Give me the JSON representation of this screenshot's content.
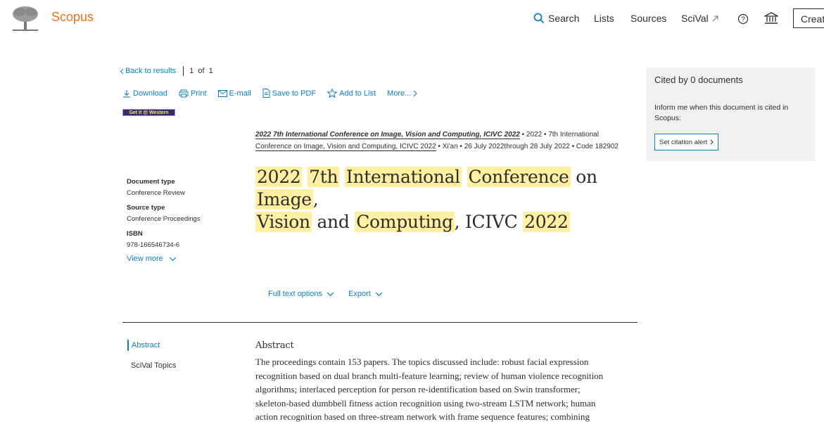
{
  "header": {
    "brand": "Scopus",
    "nav": {
      "search": "Search",
      "lists": "Lists",
      "sources": "Sources",
      "scival": "SciVal"
    },
    "create": "Creat"
  },
  "back": {
    "back_label": "Back to results",
    "pager": "1  of  1"
  },
  "toolbar": {
    "download": "Download",
    "print": "Print",
    "email": "E-mail",
    "save_pdf": "Save to PDF",
    "add_list": "Add to List",
    "more": "More..."
  },
  "getit": "Get it @ Western",
  "source": {
    "title": "2022 7th International Conference on Image, Vision and Computing, ICIVC 2022",
    "year": "2022",
    "conf_a": "7th International",
    "conf_b": "Conference on Image, Vision and Computing, ICIVC 2022",
    "location": "Xi'an",
    "dates": "26 July 2022through 28 July 2022",
    "code": "Code 182902"
  },
  "title_words": [
    "2022",
    "7th",
    "International",
    "Conference",
    "on",
    "Image",
    ",",
    "Vision",
    "and",
    "Computing",
    ", ICIVC",
    "2022"
  ],
  "meta": {
    "doc_type_label": "Document type",
    "doc_type": "Conference Review",
    "source_type_label": "Source type",
    "source_type": "Conference Proceedings",
    "isbn_label": "ISBN",
    "isbn": "978-166546734-6",
    "view_more": "View more"
  },
  "actions": {
    "full_text": "Full text options",
    "export": "Export"
  },
  "side_nav": {
    "abstract": "Abstract",
    "scival_topics": "SciVal Topics"
  },
  "abstract": {
    "heading": "Abstract",
    "lines": [
      "The proceedings contain 153 papers. The topics discussed include: robust facial expression",
      "recognition based on dual branch multi-feature learning; review of human violence recognition",
      "algorithms; interlaced perception for person re-identification based on Swin transformer;",
      "skeleton-based dumbbell fitness action recognition using two-stream LSTM network; human",
      "action recognition based on three-stream network with frame sequence features; combining"
    ]
  },
  "cited": {
    "title": "Cited by 0 documents",
    "inform": "Inform me when this document is cited in Scopus:",
    "alert_button": "Set citation alert"
  },
  "colors": {
    "brand": "#e9711c",
    "link": "#0c7dbb",
    "highlight": "#fff0a1",
    "panel": "#f1f1f1"
  }
}
